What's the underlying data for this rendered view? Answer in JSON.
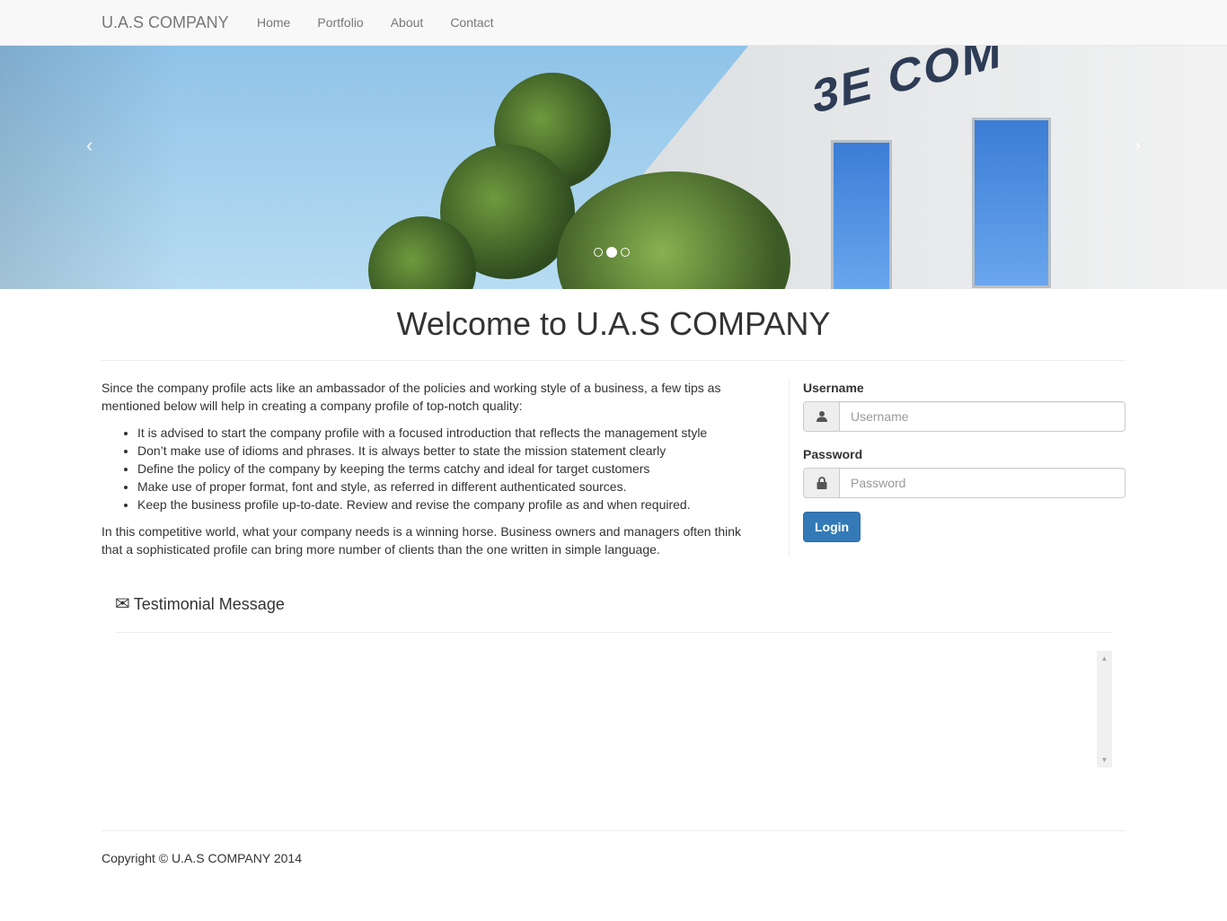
{
  "navbar": {
    "brand": "U.A.S COMPANY",
    "links": [
      {
        "label": "Home"
      },
      {
        "label": "Portfolio"
      },
      {
        "label": "About"
      },
      {
        "label": "Contact"
      }
    ]
  },
  "carousel": {
    "image_text": "3E COM",
    "prev_icon": "‹",
    "next_icon": "›",
    "slide_count": 3,
    "active_slide": 2
  },
  "main": {
    "title": "Welcome to U.A.S COMPANY",
    "intro_paragraph": "Since the company profile acts like an ambassador of the policies and working style of a business, a few tips as mentioned below will help in creating a company profile of top-notch quality:",
    "tips": [
      "It is advised to start the company profile with a focused introduction that reflects the management style",
      "Don’t make use of idioms and phrases. It is always better to state the mission statement clearly",
      "Define the policy of the company by keeping the terms catchy and ideal for target customers",
      "Make use of proper format, font and style, as referred in different authenticated sources.",
      "Keep the business profile up-to-date. Review and revise the company profile as and when required."
    ],
    "closing_paragraph": "In this competitive world, what your company needs is a winning horse. Business owners and managers often think that a sophisticated profile can bring more number of clients than the one written in simple language."
  },
  "login": {
    "username_label": "Username",
    "username_placeholder": "Username",
    "username_value": "",
    "password_label": "Password",
    "password_placeholder": "Password",
    "password_value": "",
    "button_label": "Login",
    "accent_color": "#337ab7"
  },
  "testimonial": {
    "icon": "✉",
    "heading": "Testimonial Message",
    "scroll_up_icon": "▲",
    "scroll_down_icon": "▼"
  },
  "footer": {
    "copyright": "Copyright © U.A.S COMPANY 2014"
  }
}
